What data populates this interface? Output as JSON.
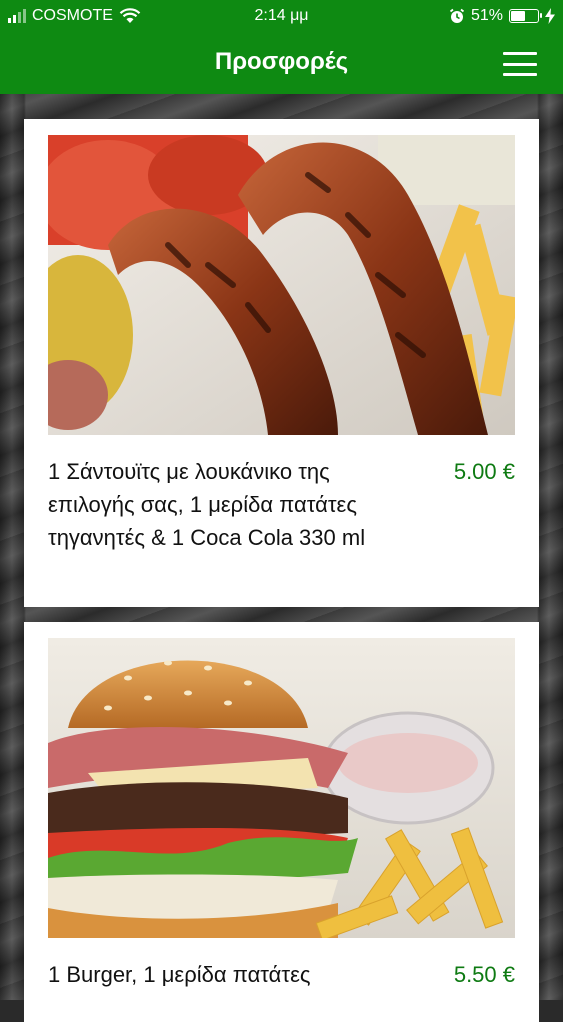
{
  "status_bar": {
    "carrier": "COSMOTE",
    "time": "2:14 μμ",
    "battery_percent": "51%",
    "battery_level": 0.51,
    "icons": [
      "signal-icon",
      "wifi-icon",
      "alarm-icon",
      "battery-icon",
      "charging-bolt-icon"
    ]
  },
  "header": {
    "title": "Προσφορές",
    "menu_icon": "hamburger-menu-icon"
  },
  "colors": {
    "brand_green": "#0e8a12",
    "price_green": "#0e7a12"
  },
  "offers": [
    {
      "image": "sausages-with-fries-photo",
      "description": "1 Σάντουϊτς με λουκάνικο της επιλογής σας, 1 μερίδα πατάτες τηγανητές & 1 Coca Cola 330 ml",
      "price": "5.00 €"
    },
    {
      "image": "burger-with-fries-photo",
      "description": "1 Burger, 1 μερίδα πατάτες",
      "price": "5.50 €"
    }
  ]
}
